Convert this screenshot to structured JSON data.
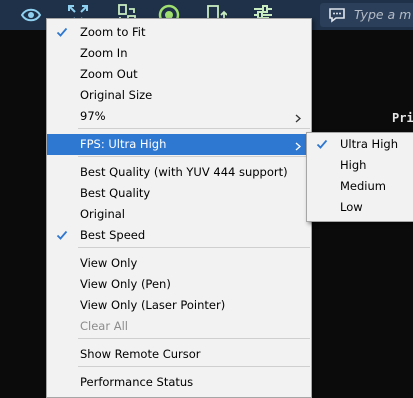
{
  "toolbar": {
    "icons": [
      "eye-icon",
      "fit-screen-icon",
      "file-transfer-icon",
      "record-icon",
      "swap-icon",
      "settings-sliders-icon"
    ],
    "chat_placeholder": "Type a me"
  },
  "remote_screen_text": "Pri",
  "view_menu": {
    "items": [
      {
        "label": "Zoom to Fit",
        "checked": true
      },
      {
        "label": "Zoom In"
      },
      {
        "label": "Zoom Out"
      },
      {
        "label": "Original Size"
      },
      {
        "label": "97%",
        "has_submenu": true
      },
      {
        "label": "FPS: Ultra High",
        "has_submenu": true,
        "highlighted": true
      },
      {
        "label": "Best Quality (with YUV 444 support)"
      },
      {
        "label": "Best Quality"
      },
      {
        "label": "Original"
      },
      {
        "label": "Best Speed",
        "checked": true
      },
      {
        "label": "View Only"
      },
      {
        "label": "View Only (Pen)"
      },
      {
        "label": "View Only (Laser Pointer)"
      },
      {
        "label": "Clear All",
        "disabled": true
      },
      {
        "label": "Show Remote Cursor"
      },
      {
        "label": "Performance Status"
      }
    ]
  },
  "fps_submenu": {
    "items": [
      {
        "label": "Ultra High",
        "checked": true
      },
      {
        "label": "High"
      },
      {
        "label": "Medium"
      },
      {
        "label": "Low"
      }
    ]
  },
  "colors": {
    "toolbar": "#1f3148",
    "menu_background": "#f2f2f2",
    "highlight": "#2f78d2",
    "check_accent": "#2f78d2"
  }
}
